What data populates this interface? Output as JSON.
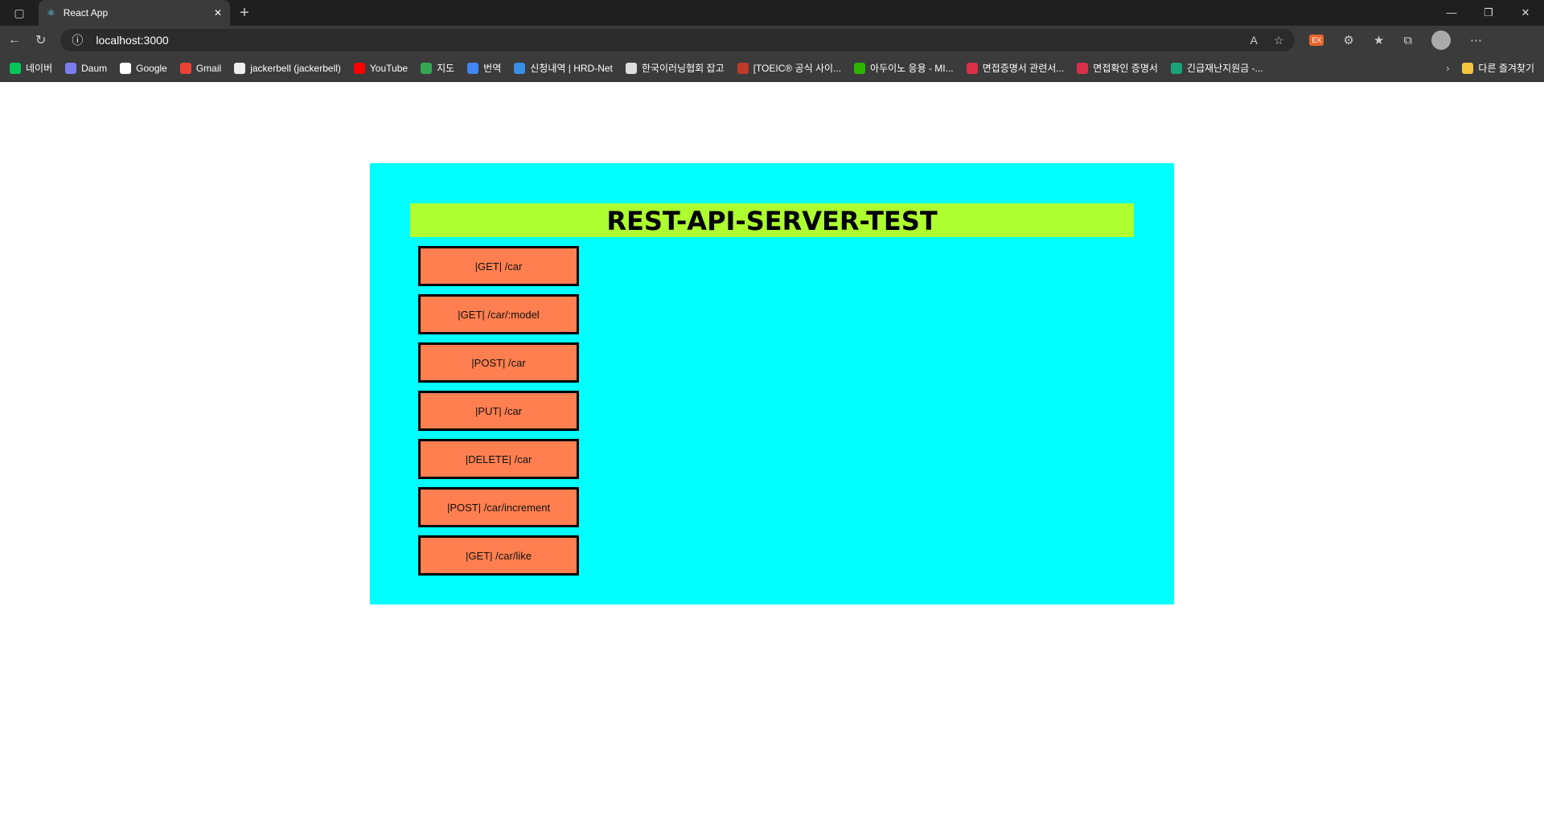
{
  "browser": {
    "tab_title": "React App",
    "url": "localhost:3000",
    "bookmarks": [
      {
        "label": "네이버",
        "color": "#03c75a"
      },
      {
        "label": "Daum",
        "color": "#7c7cf0"
      },
      {
        "label": "Google",
        "color": "#ffffff"
      },
      {
        "label": "Gmail",
        "color": "#ea4335"
      },
      {
        "label": "jackerbell (jackerbell)",
        "color": "#eeeeee"
      },
      {
        "label": "YouTube",
        "color": "#ff0000"
      },
      {
        "label": "지도",
        "color": "#34a853"
      },
      {
        "label": "번역",
        "color": "#4285f4"
      },
      {
        "label": "신청내역 | HRD-Net",
        "color": "#3a8ee6"
      },
      {
        "label": "한국이러닝협회 잡고",
        "color": "#dddddd"
      },
      {
        "label": "[TOEIC® 공식 사이...",
        "color": "#c0392b"
      },
      {
        "label": "아두이노 응용 - MI...",
        "color": "#2db400"
      },
      {
        "label": "면접증명서 관련서...",
        "color": "#d9304a"
      },
      {
        "label": "면접확인 증명서",
        "color": "#d9304a"
      },
      {
        "label": "긴급재난지원금 -...",
        "color": "#1aa37a"
      }
    ],
    "other_bookmarks": "다른 즐겨찾기"
  },
  "page": {
    "title": "REST-API-SERVER-TEST",
    "colors": {
      "panel": "#00ffff",
      "header": "#adff2f",
      "button": "#ff7f50"
    },
    "buttons": [
      "|GET| /car",
      "|GET| /car/:model",
      "|POST| /car",
      "|PUT| /car",
      "|DELETE| /car",
      "|POST| /car/increment",
      "|GET| /car/like"
    ]
  }
}
